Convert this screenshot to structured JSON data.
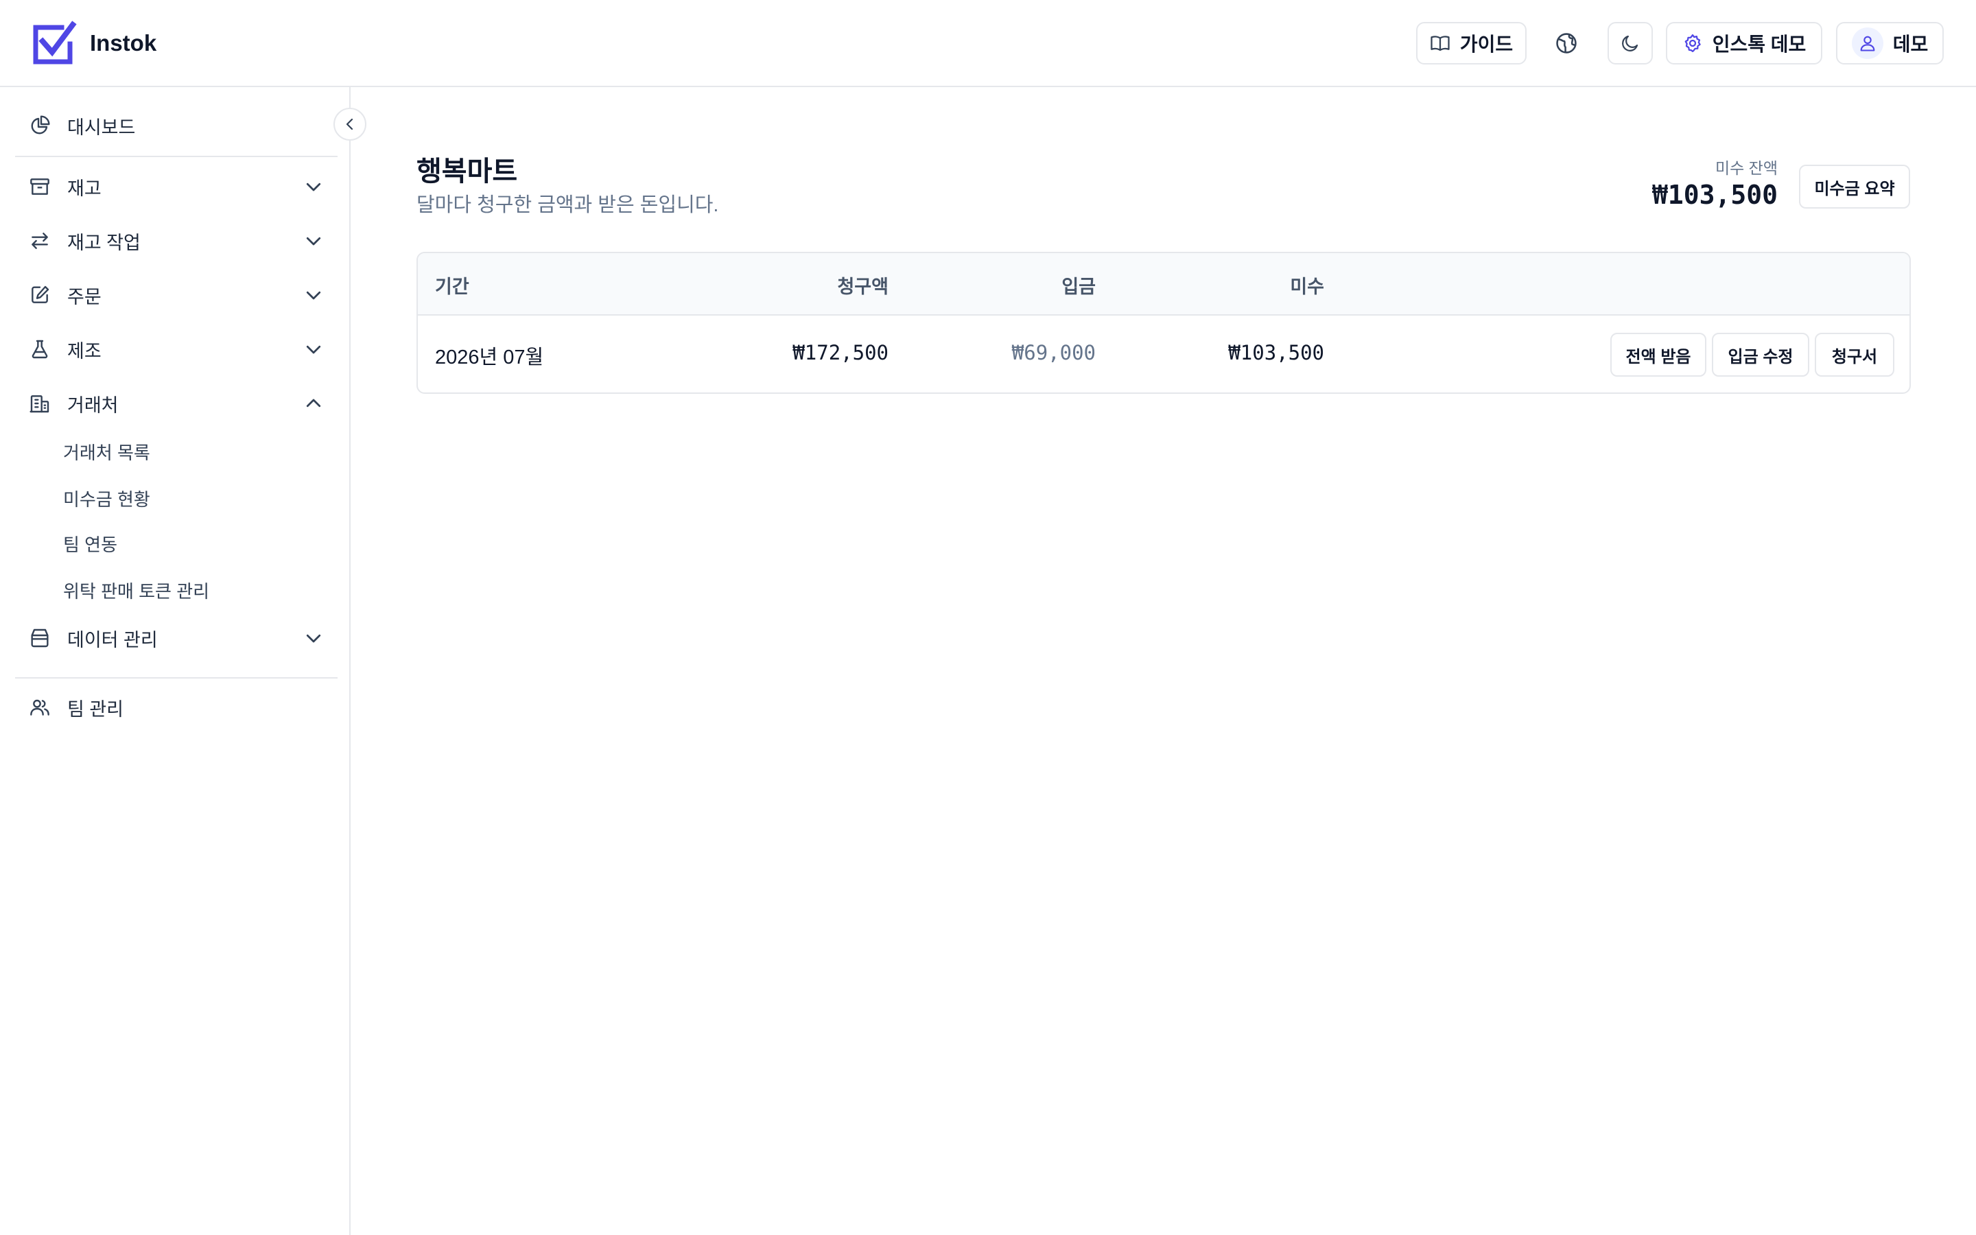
{
  "header": {
    "brand": "Instok",
    "guide_label": "가이드",
    "workspace_label": "인스톡 데모",
    "user_label": "데모"
  },
  "sidebar": {
    "dashboard": "대시보드",
    "items": [
      {
        "label": "재고",
        "icon": "archive-icon",
        "expanded": false
      },
      {
        "label": "재고 작업",
        "icon": "transfer-arrows-icon",
        "expanded": false
      },
      {
        "label": "주문",
        "icon": "edit-note-icon",
        "expanded": false
      },
      {
        "label": "제조",
        "icon": "flask-icon",
        "expanded": false
      },
      {
        "label": "거래처",
        "icon": "building-icon",
        "expanded": true
      },
      {
        "label": "데이터 관리",
        "icon": "database-icon",
        "expanded": false
      }
    ],
    "partner_subitems": [
      "거래처 목록",
      "미수금 현황",
      "팀 연동",
      "위탁 판매 토큰 관리"
    ],
    "team": "팀 관리"
  },
  "page": {
    "title": "행복마트",
    "subtitle": "달마다 청구한 금액과 받은 돈입니다.",
    "balance_label": "미수 잔액",
    "balance_value": "₩103,500",
    "summary_button": "미수금 요약"
  },
  "table": {
    "headers": {
      "period": "기간",
      "billed": "청구액",
      "paid": "입금",
      "outstanding": "미수"
    },
    "rows": [
      {
        "period": "2026년 07월",
        "billed": "₩172,500",
        "paid": "₩69,000",
        "outstanding": "₩103,500",
        "actions": [
          "전액 받음",
          "입금 수정",
          "청구서"
        ]
      }
    ]
  },
  "colors": {
    "brand": "#4f46e5",
    "text": "#0f172a",
    "muted": "#64748b",
    "border": "#e5e7eb",
    "header_bg": "#f8fafc"
  }
}
